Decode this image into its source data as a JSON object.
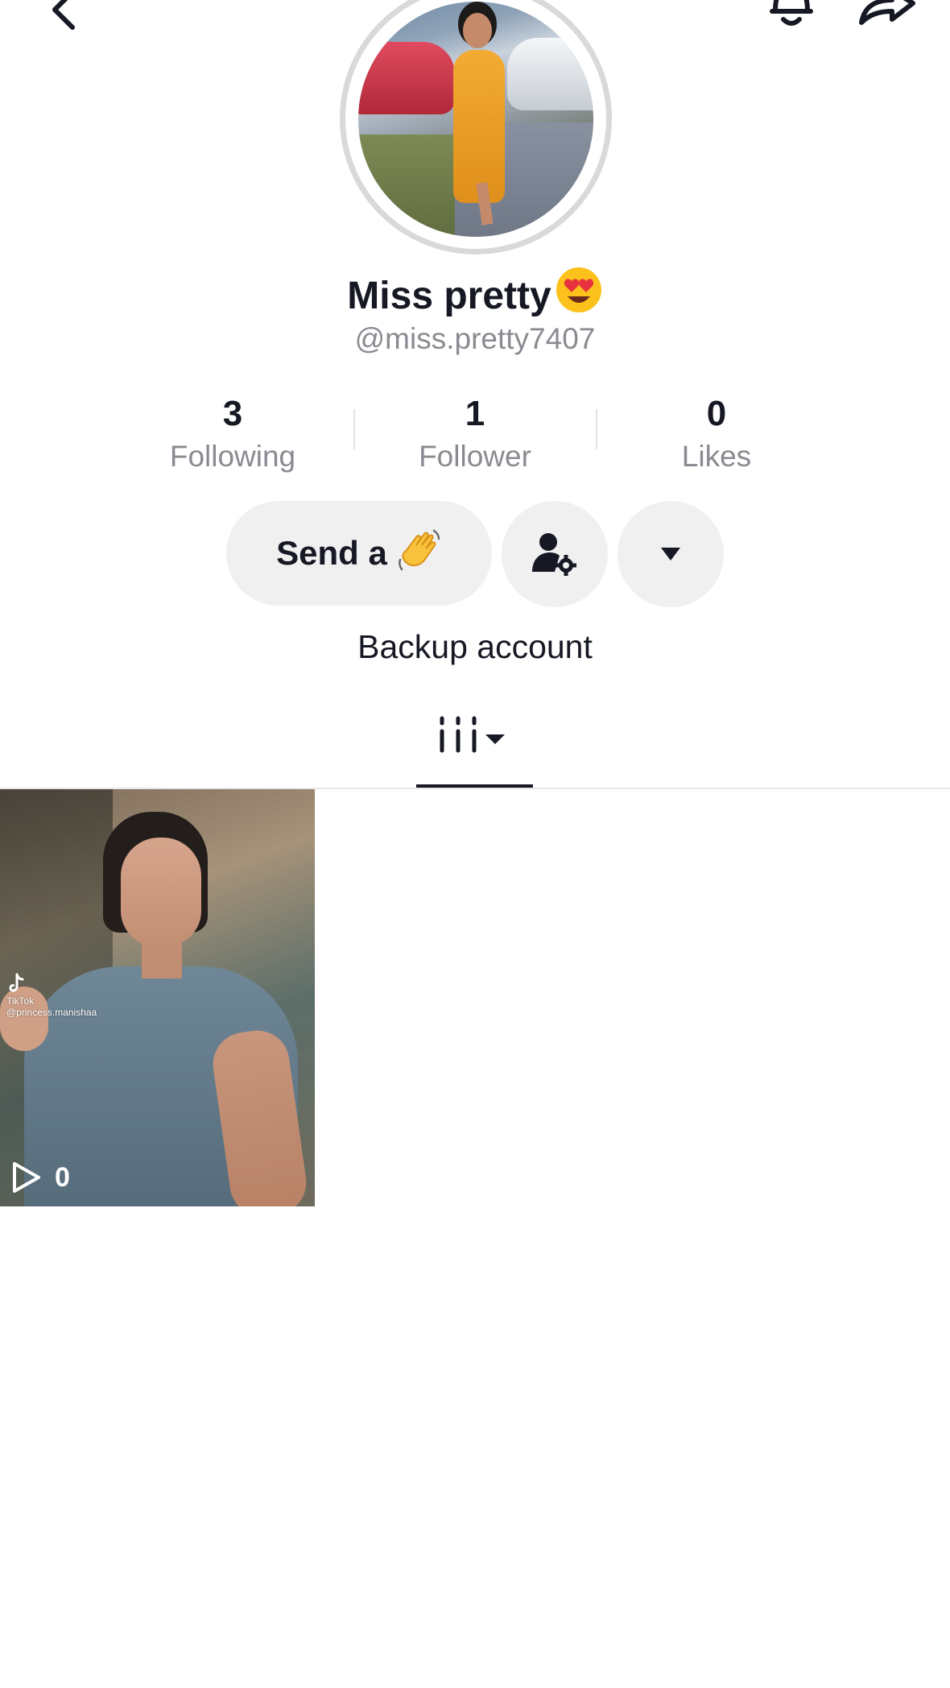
{
  "topbar": {
    "back_icon": "chevron-left-icon",
    "bell_icon": "bell-icon",
    "share_icon": "share-arrow-icon"
  },
  "profile": {
    "display_name": "Miss pretty",
    "name_emoji": "😍",
    "username": "@miss.pretty7407",
    "bio": "Backup account"
  },
  "stats": [
    {
      "value": "3",
      "label": "Following"
    },
    {
      "value": "1",
      "label": "Follower"
    },
    {
      "value": "0",
      "label": "Likes"
    }
  ],
  "actions": {
    "send_label": "Send a",
    "send_emoji": "👋",
    "settings_icon": "user-gear-icon",
    "more_icon": "caret-down-icon"
  },
  "tabs": {
    "active_icon": "video-grid-icon"
  },
  "videos": [
    {
      "views": "0",
      "watermark_brand": "TikTok",
      "watermark_user": "@princess.manishaa"
    }
  ],
  "colors": {
    "text_primary": "#161823",
    "text_secondary": "#8a8b91",
    "button_bg": "#f0f0f1",
    "divider": "#e8e8e9"
  }
}
